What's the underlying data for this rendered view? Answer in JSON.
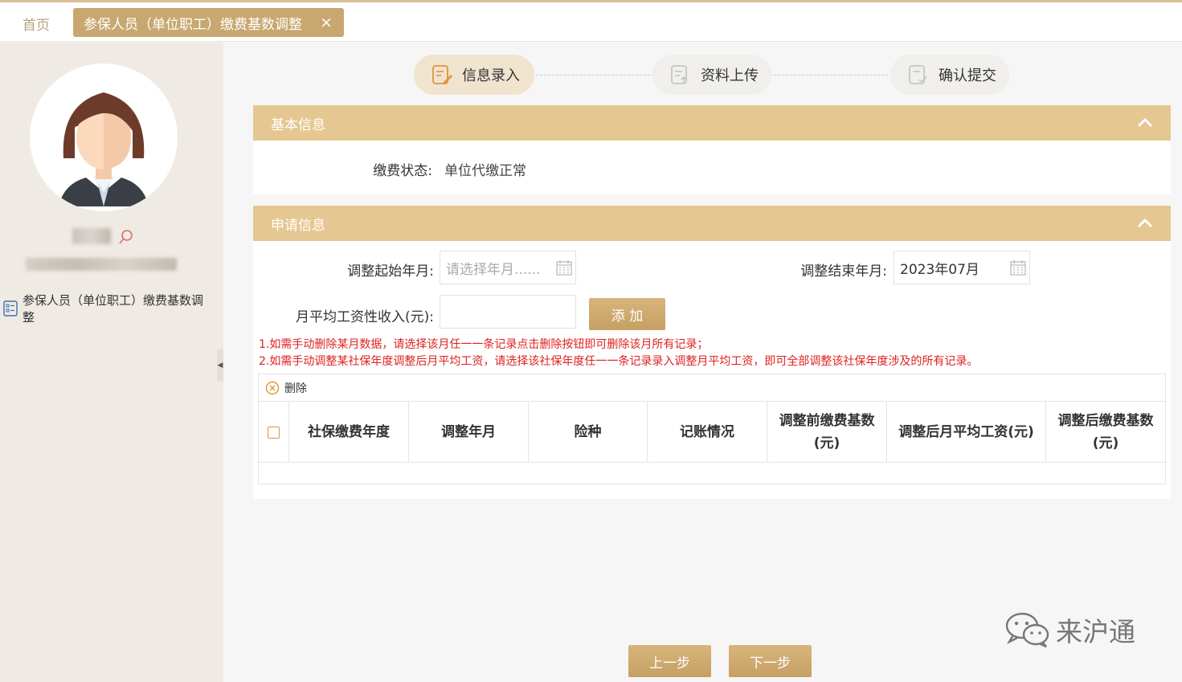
{
  "tabs": {
    "home": "首页",
    "active": "参保人员（单位职工）缴费基数调整",
    "close": "×"
  },
  "sidebar": {
    "menu_item": "参保人员（单位职工）缴费基数调整"
  },
  "steps": [
    {
      "label": "信息录入",
      "active": true
    },
    {
      "label": "资料上传",
      "active": false
    },
    {
      "label": "确认提交",
      "active": false
    }
  ],
  "basic_info": {
    "title": "基本信息",
    "status_label": "缴费状态:",
    "status_value": "单位代缴正常"
  },
  "apply_info": {
    "title": "申请信息",
    "start_label": "调整起始年月:",
    "start_placeholder": "请选择年月......",
    "end_label": "调整结束年月:",
    "end_value": "2023年07月",
    "income_label": "月平均工资性收入(元):",
    "add_button": "添 加"
  },
  "notes": [
    "1.如需手动删除某月数据，请选择该月任一一条记录点击删除按钮即可删除该月所有记录；",
    "2.如需手动调整某社保年度调整后月平均工资，请选择该社保年度任一一条记录录入调整月平均工资，即可全部调整该社保年度涉及的所有记录。"
  ],
  "table": {
    "delete_label": "删除",
    "columns": [
      "社保缴费年度",
      "调整年月",
      "险种",
      "记账情况",
      "调整前缴费基数(元)",
      "调整后月平均工资(元)",
      "调整后缴费基数(元)"
    ],
    "rows": []
  },
  "footer": {
    "prev": "上一步",
    "next": "下一步"
  },
  "watermark": "来沪通",
  "colors": {
    "accent": "#c8a870",
    "panel_header": "#e5c791",
    "notice": "#e02020"
  }
}
